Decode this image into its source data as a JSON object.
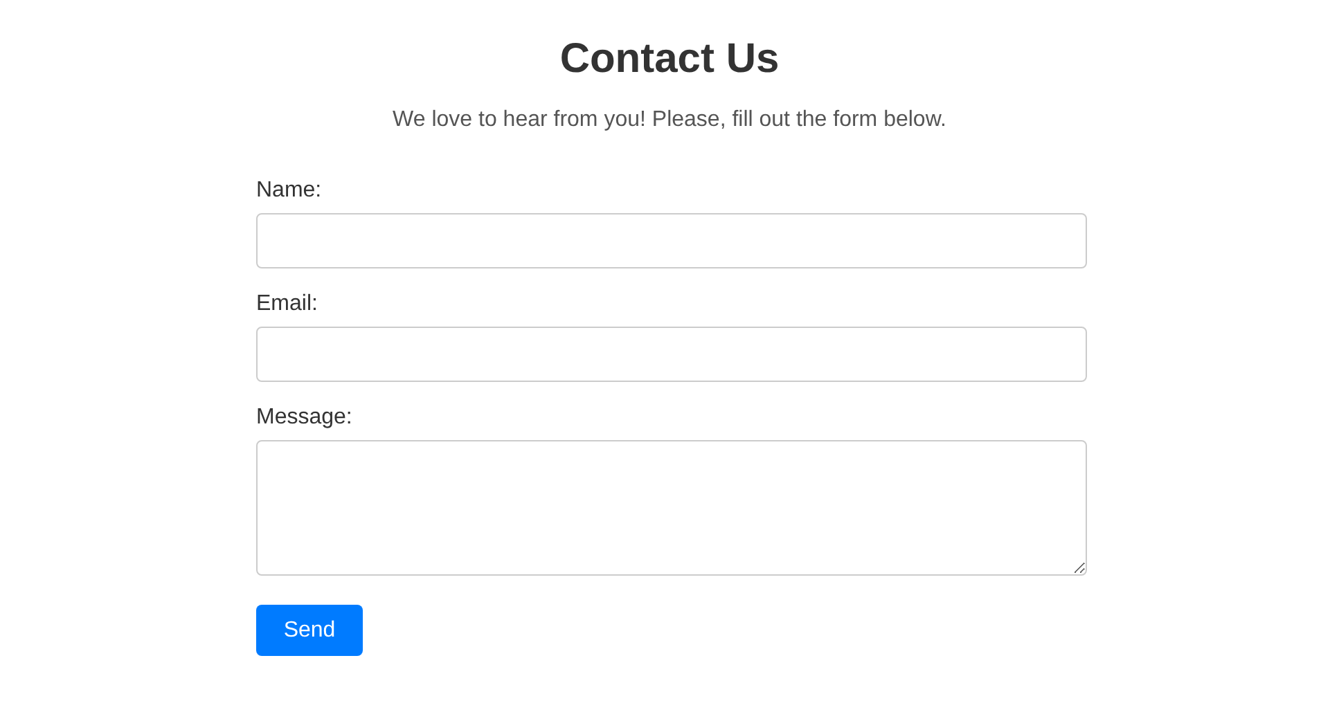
{
  "title": "Contact Us",
  "subtitle": "We love to hear from you! Please, fill out the form below.",
  "fields": [
    {
      "label": "Name:",
      "kind": "text"
    },
    {
      "label": "Email:",
      "kind": "text"
    },
    {
      "label": "Message:",
      "kind": "textarea"
    }
  ],
  "submit_button": "Send"
}
